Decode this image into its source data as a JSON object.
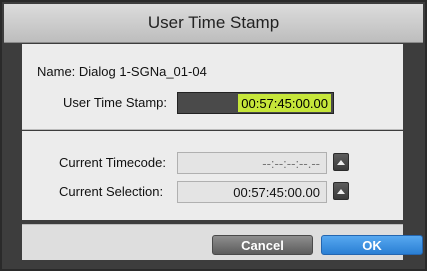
{
  "dialog": {
    "title": "User Time Stamp"
  },
  "name_row": {
    "text": "Name:  Dialog 1-SGNa_01-04"
  },
  "user_time_stamp": {
    "label": "User Time Stamp:",
    "value": "00:57:45:00.00"
  },
  "current_timecode": {
    "label": "Current Timecode:",
    "value": "--:--:--:--.--"
  },
  "current_selection": {
    "label": "Current Selection:",
    "value": "00:57:45:00.00"
  },
  "buttons": {
    "cancel": "Cancel",
    "ok": "OK"
  },
  "colors": {
    "highlight": "#c6e63a",
    "ok_button": "#2a7fd4"
  },
  "icons": {
    "timecode_button": "up-triangle-icon",
    "selection_button": "up-triangle-icon"
  }
}
